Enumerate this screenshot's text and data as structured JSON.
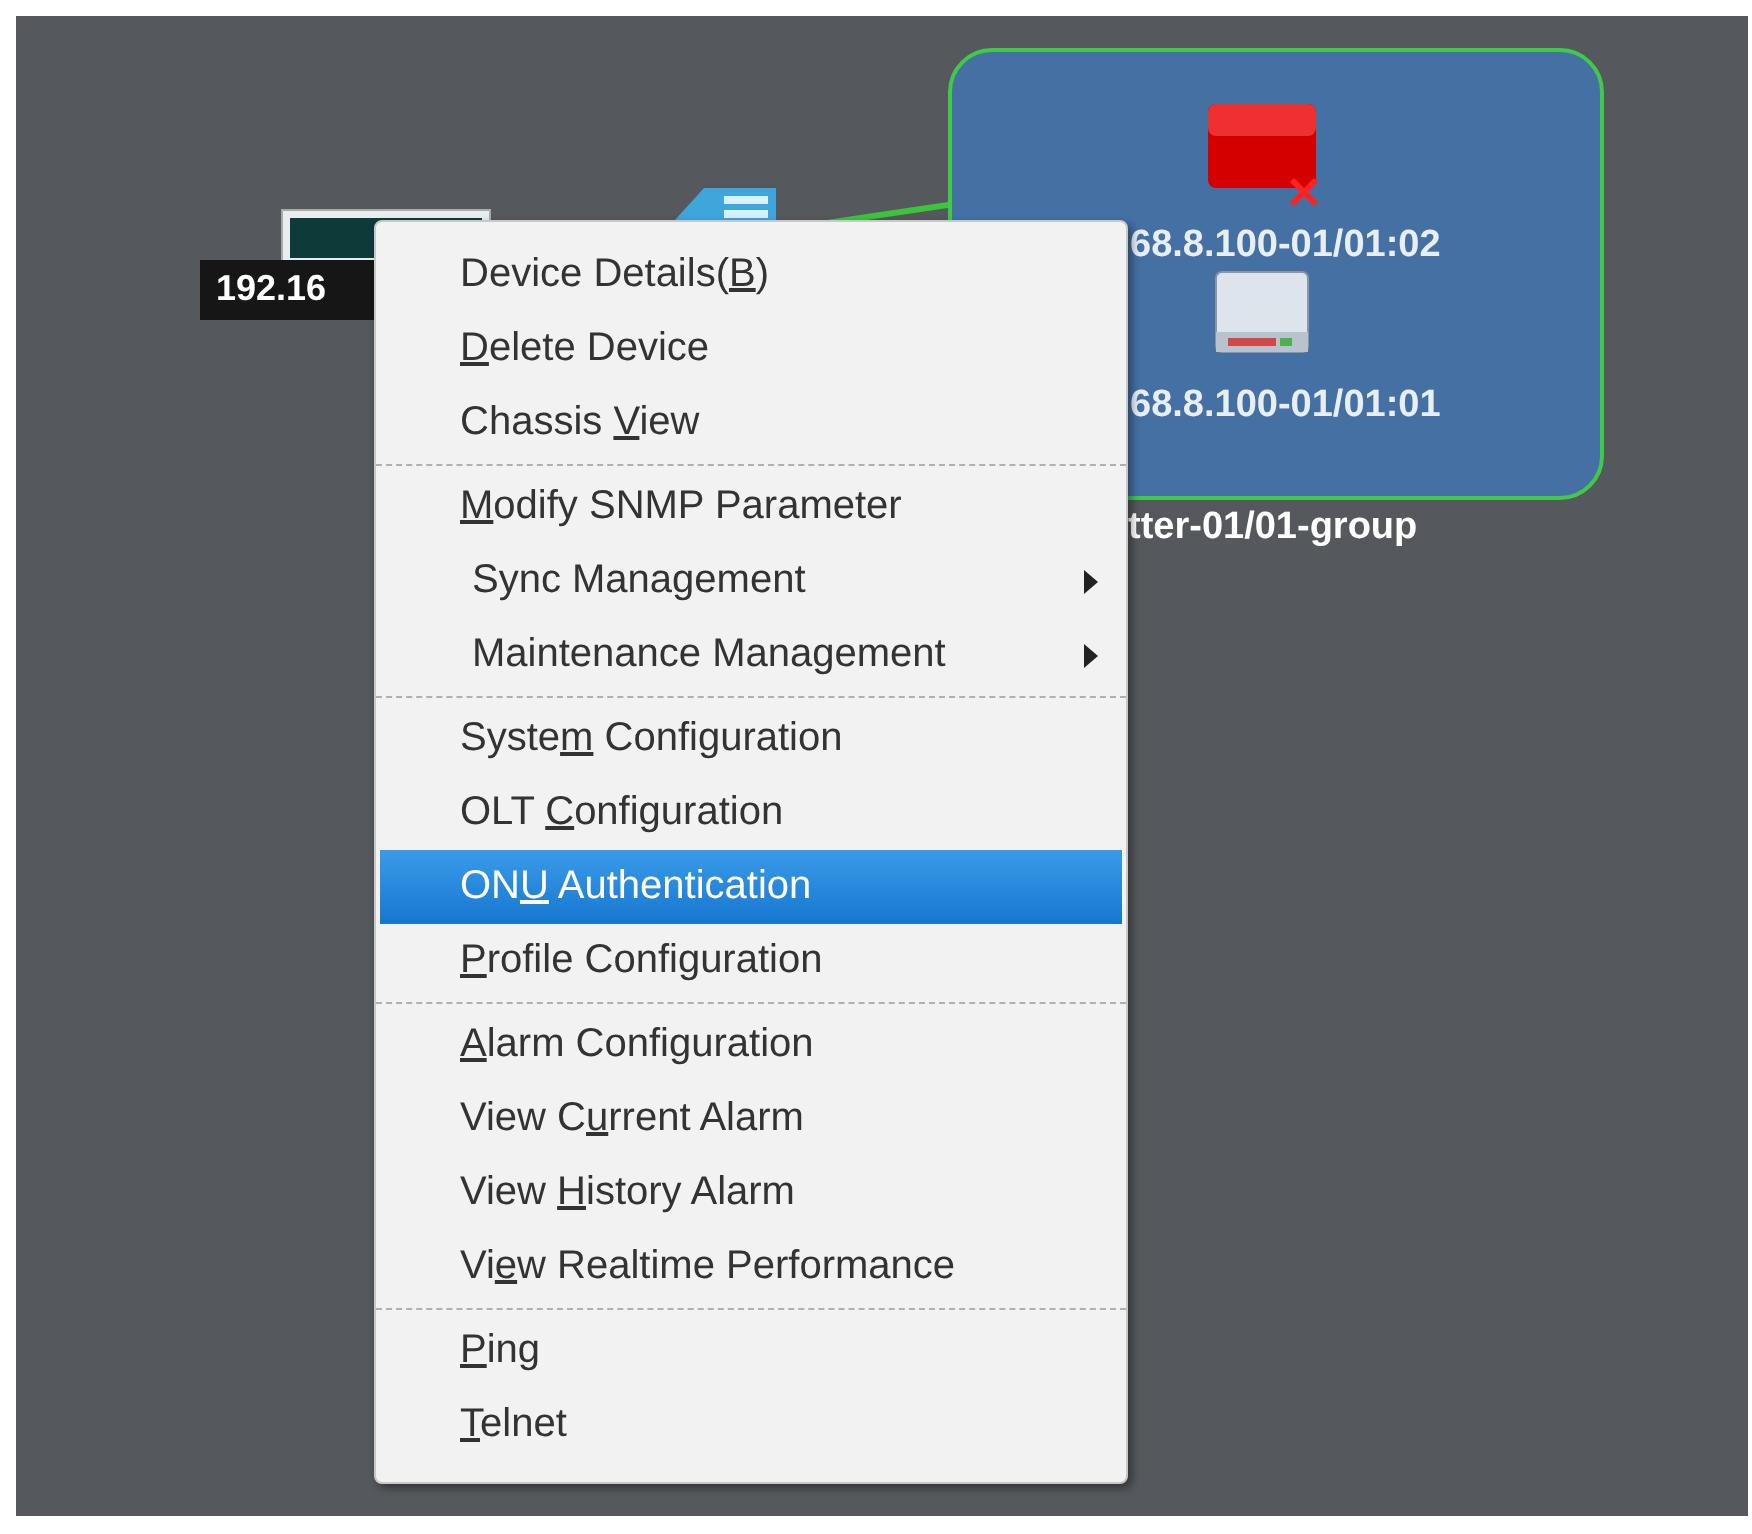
{
  "canvas": {
    "nodes": [
      {
        "kind": "pc",
        "label": "192.16"
      },
      {
        "kind": "switch"
      }
    ],
    "group": {
      "label": "tter-01/01-group",
      "devices": [
        {
          "kind": "onu",
          "alarm": true,
          "label": "68.8.100-01/01:02"
        },
        {
          "kind": "onu",
          "alarm": false,
          "label": "68.8.100-01/01:01"
        }
      ]
    }
  },
  "context_menu": {
    "groups": [
      [
        {
          "label": [
            {
              "text": "Device Details(",
              "underline": false
            },
            {
              "text": "B",
              "underline": true
            },
            {
              "text": ")",
              "underline": false
            }
          ],
          "submenu": false,
          "selected": false
        },
        {
          "label": [
            {
              "text": "D",
              "underline": true
            },
            {
              "text": "elete Device",
              "underline": false
            }
          ],
          "submenu": false,
          "selected": false
        },
        {
          "label": [
            {
              "text": "Chassis ",
              "underline": false
            },
            {
              "text": "V",
              "underline": true
            },
            {
              "text": "iew",
              "underline": false
            }
          ],
          "submenu": false,
          "selected": false
        }
      ],
      [
        {
          "label": [
            {
              "text": "M",
              "underline": true
            },
            {
              "text": "odify SNMP Parameter",
              "underline": false
            }
          ],
          "submenu": false,
          "selected": false
        },
        {
          "label": [
            {
              "text": "Sync Management",
              "underline": false
            }
          ],
          "submenu": true,
          "selected": false
        },
        {
          "label": [
            {
              "text": "Maintenance Management",
              "underline": false
            }
          ],
          "submenu": true,
          "selected": false
        }
      ],
      [
        {
          "label": [
            {
              "text": "Syste",
              "underline": false
            },
            {
              "text": "m",
              "underline": true
            },
            {
              "text": " Configuration",
              "underline": false
            }
          ],
          "submenu": false,
          "selected": false
        },
        {
          "label": [
            {
              "text": "OLT ",
              "underline": false
            },
            {
              "text": "C",
              "underline": true
            },
            {
              "text": "onfiguration",
              "underline": false
            }
          ],
          "submenu": false,
          "selected": false
        },
        {
          "label": [
            {
              "text": "ON",
              "underline": false
            },
            {
              "text": "U",
              "underline": true
            },
            {
              "text": " Authentication",
              "underline": false
            }
          ],
          "submenu": false,
          "selected": true
        },
        {
          "label": [
            {
              "text": "P",
              "underline": true
            },
            {
              "text": "rofile Configuration",
              "underline": false
            }
          ],
          "submenu": false,
          "selected": false
        }
      ],
      [
        {
          "label": [
            {
              "text": "A",
              "underline": true
            },
            {
              "text": "larm Configuration",
              "underline": false
            }
          ],
          "submenu": false,
          "selected": false
        },
        {
          "label": [
            {
              "text": "View C",
              "underline": false
            },
            {
              "text": "u",
              "underline": true
            },
            {
              "text": "rrent Alarm",
              "underline": false
            }
          ],
          "submenu": false,
          "selected": false
        },
        {
          "label": [
            {
              "text": "View ",
              "underline": false
            },
            {
              "text": "H",
              "underline": true
            },
            {
              "text": "istory Alarm",
              "underline": false
            }
          ],
          "submenu": false,
          "selected": false
        },
        {
          "label": [
            {
              "text": "Vi",
              "underline": false
            },
            {
              "text": "e",
              "underline": true
            },
            {
              "text": "w Realtime Performance",
              "underline": false
            }
          ],
          "submenu": false,
          "selected": false
        }
      ],
      [
        {
          "label": [
            {
              "text": "P",
              "underline": true
            },
            {
              "text": "ing",
              "underline": false
            }
          ],
          "submenu": false,
          "selected": false
        },
        {
          "label": [
            {
              "text": "T",
              "underline": true
            },
            {
              "text": "elnet",
              "underline": false
            }
          ],
          "submenu": false,
          "selected": false
        }
      ]
    ]
  }
}
